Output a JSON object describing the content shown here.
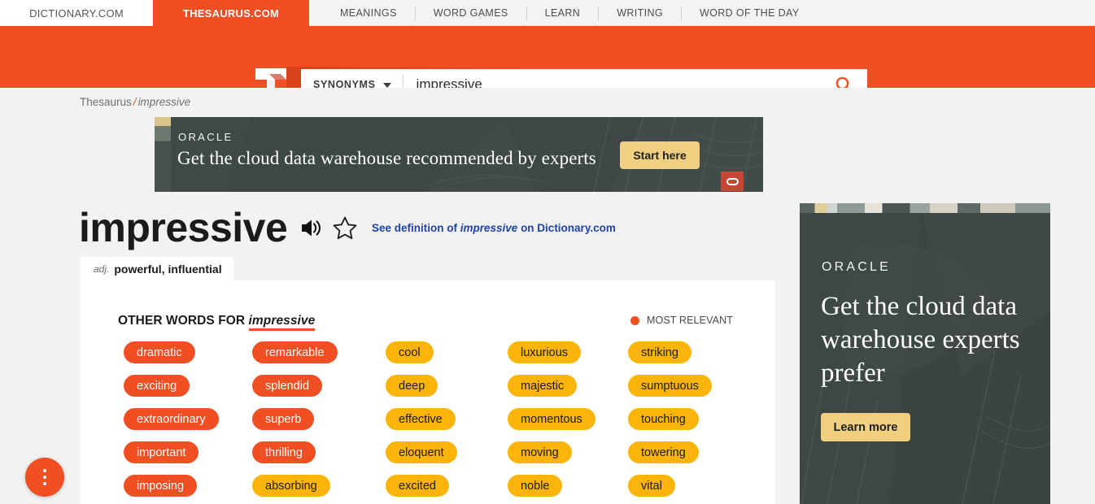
{
  "topnav": {
    "sites": [
      {
        "label": "DICTIONARY.COM",
        "active": false
      },
      {
        "label": "THESAURUS.COM",
        "active": true
      }
    ],
    "links": [
      "MEANINGS",
      "WORD GAMES",
      "LEARN",
      "WRITING",
      "WORD OF THE DAY"
    ]
  },
  "search": {
    "logo_alt": "thesaurus-t-logo",
    "type_label": "SYNONYMS",
    "value": "impressive",
    "placeholder": "",
    "submit_icon": "search-icon"
  },
  "breadcrumb": {
    "root": "Thesaurus",
    "separator": "/",
    "current": "impressive"
  },
  "banner_ad": {
    "brand": "ORACLE",
    "headline": "Get the cloud data warehouse recommended by experts",
    "cta": "Start here",
    "badge_icon": "oracle-o-icon"
  },
  "word": {
    "title": "impressive",
    "audio_icon": "speaker-icon",
    "favorite_icon": "star-outline-icon",
    "see_definition_prefix": "See definition of ",
    "see_definition_word": "impressive",
    "see_definition_suffix": " on Dictionary.com"
  },
  "pos_tab": {
    "pos": "adj.",
    "words": "powerful, influential"
  },
  "card": {
    "heading_prefix": "OTHER WORDS FOR ",
    "heading_word": "impressive",
    "relevance_label": "MOST RELEVANT",
    "relevance_dot_color": "#f04e23",
    "columns": [
      {
        "chips": [
          {
            "word": "dramatic",
            "level": 3
          },
          {
            "word": "exciting",
            "level": 3
          },
          {
            "word": "extraordinary",
            "level": 3
          },
          {
            "word": "important",
            "level": 3
          },
          {
            "word": "imposing",
            "level": 3
          }
        ]
      },
      {
        "chips": [
          {
            "word": "remarkable",
            "level": 3
          },
          {
            "word": "splendid",
            "level": 3
          },
          {
            "word": "superb",
            "level": 3
          },
          {
            "word": "thrilling",
            "level": 3
          },
          {
            "word": "absorbing",
            "level": 2
          }
        ]
      },
      {
        "chips": [
          {
            "word": "cool",
            "level": 2
          },
          {
            "word": "deep",
            "level": 2
          },
          {
            "word": "effective",
            "level": 2
          },
          {
            "word": "eloquent",
            "level": 2
          },
          {
            "word": "excited",
            "level": 2
          }
        ]
      },
      {
        "chips": [
          {
            "word": "luxurious",
            "level": 2
          },
          {
            "word": "majestic",
            "level": 2
          },
          {
            "word": "momentous",
            "level": 2
          },
          {
            "word": "moving",
            "level": 2
          },
          {
            "word": "noble",
            "level": 2
          }
        ]
      },
      {
        "chips": [
          {
            "word": "striking",
            "level": 2
          },
          {
            "word": "sumptuous",
            "level": 2
          },
          {
            "word": "touching",
            "level": 2
          },
          {
            "word": "towering",
            "level": 2
          },
          {
            "word": "vital",
            "level": 2
          }
        ]
      }
    ]
  },
  "side_ad": {
    "brand": "ORACLE",
    "headline": "Get the cloud data warehouse experts prefer",
    "cta": "Learn more"
  },
  "fab": {
    "icon": "more-vertical-icon"
  },
  "colors": {
    "brand_orange": "#f04e23",
    "chip_level3": "#f04e23",
    "chip_level2": "#fbb40a",
    "link_blue": "#1d43ad",
    "page_bg": "#f2f2f2"
  }
}
